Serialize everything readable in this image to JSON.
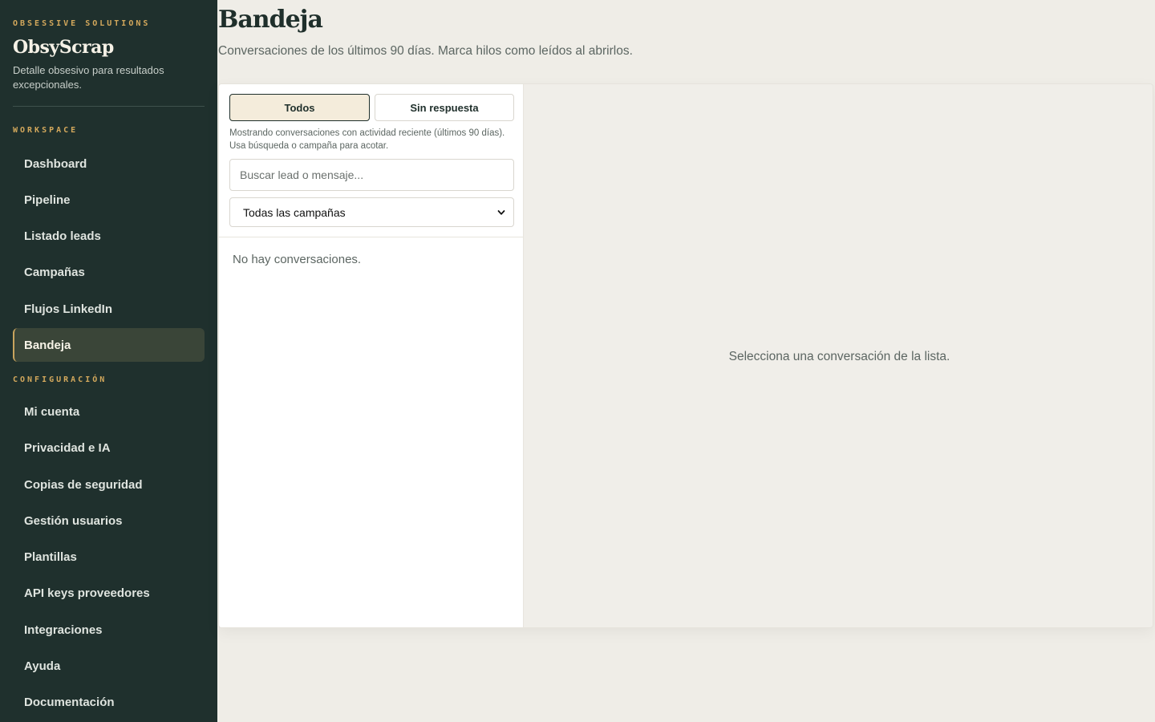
{
  "sidebar": {
    "eyebrow": "OBSESSIVE SOLUTIONS",
    "brand": "ObsyScrap",
    "tagline": "Detalle obsesivo para resultados excepcionales.",
    "sections": [
      {
        "label": "WORKSPACE",
        "items": [
          {
            "label": "Dashboard"
          },
          {
            "label": "Pipeline"
          },
          {
            "label": "Listado leads"
          },
          {
            "label": "Campañas"
          },
          {
            "label": "Flujos LinkedIn"
          },
          {
            "label": "Bandeja",
            "active": true
          }
        ]
      },
      {
        "label": "CONFIGURACIÓN",
        "items": [
          {
            "label": "Mi cuenta"
          },
          {
            "label": "Privacidad e IA"
          },
          {
            "label": "Copias de seguridad"
          },
          {
            "label": "Gestión usuarios"
          },
          {
            "label": "Plantillas"
          },
          {
            "label": "API keys proveedores"
          },
          {
            "label": "Integraciones"
          },
          {
            "label": "Ayuda"
          },
          {
            "label": "Documentación"
          }
        ]
      }
    ]
  },
  "header": {
    "title": "Bandeja",
    "subtitle": "Conversaciones de los últimos 90 días. Marca hilos como leídos al abrirlos."
  },
  "inbox": {
    "tabs": [
      {
        "label": "Todos",
        "selected": true
      },
      {
        "label": "Sin respuesta",
        "selected": false
      }
    ],
    "hint": "Mostrando conversaciones con actividad reciente (últimos 90 días). Usa búsqueda o campaña para acotar.",
    "search": {
      "placeholder": "Buscar lead o mensaje...",
      "value": ""
    },
    "campaign_filter": {
      "selected": "Todas las campañas"
    },
    "empty_list": "No hay conversaciones.",
    "empty_detail": "Selecciona una conversación de la lista."
  },
  "colors": {
    "sidebar_bg": "#1f302d",
    "accent_gold": "#d3a85c",
    "active_item_bg": "#3a4538",
    "page_bg": "#efede7",
    "selected_tab_bg": "#f4ecdb"
  },
  "icons": {
    "select_chevron": "chevron-down-icon"
  }
}
